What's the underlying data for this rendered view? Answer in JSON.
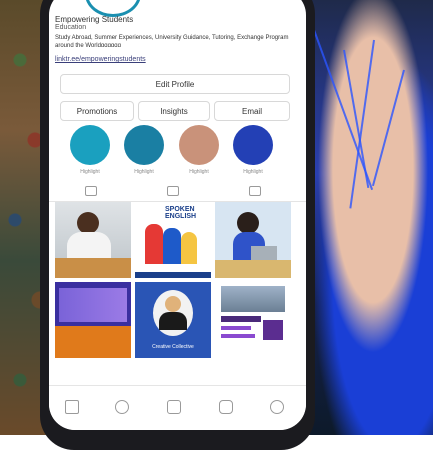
{
  "profile": {
    "name": "Empowering Students",
    "category": "Education",
    "bio": "Study Abroad, Summer Experiences, University Guidance, Tutoring, Exchange Program around the Worldɑɑɑɑɑɑ",
    "link": "linktr.ee/empoweringstudents"
  },
  "buttons": {
    "edit_profile": "Edit Profile",
    "promotions": "Promotions",
    "insights": "Insights",
    "email": "Email"
  },
  "highlights": [
    {
      "label": "Highlight",
      "color": "#1aa0bf"
    },
    {
      "label": "Highlight",
      "color": "#1a7fa3"
    },
    {
      "label": "Highlight",
      "color": "#c9927a"
    },
    {
      "label": "Highlight",
      "color": "#2340b5"
    }
  ],
  "posts": {
    "spoken_english": "SPOKEN ENGLISH",
    "creative_collective": "Creative Collective"
  },
  "bottom_nav": [
    "home-icon",
    "search-icon",
    "reels-icon",
    "shop-icon",
    "profile-icon"
  ],
  "tabs": [
    "grid-icon",
    "reels-tab-icon",
    "tagged-icon"
  ]
}
